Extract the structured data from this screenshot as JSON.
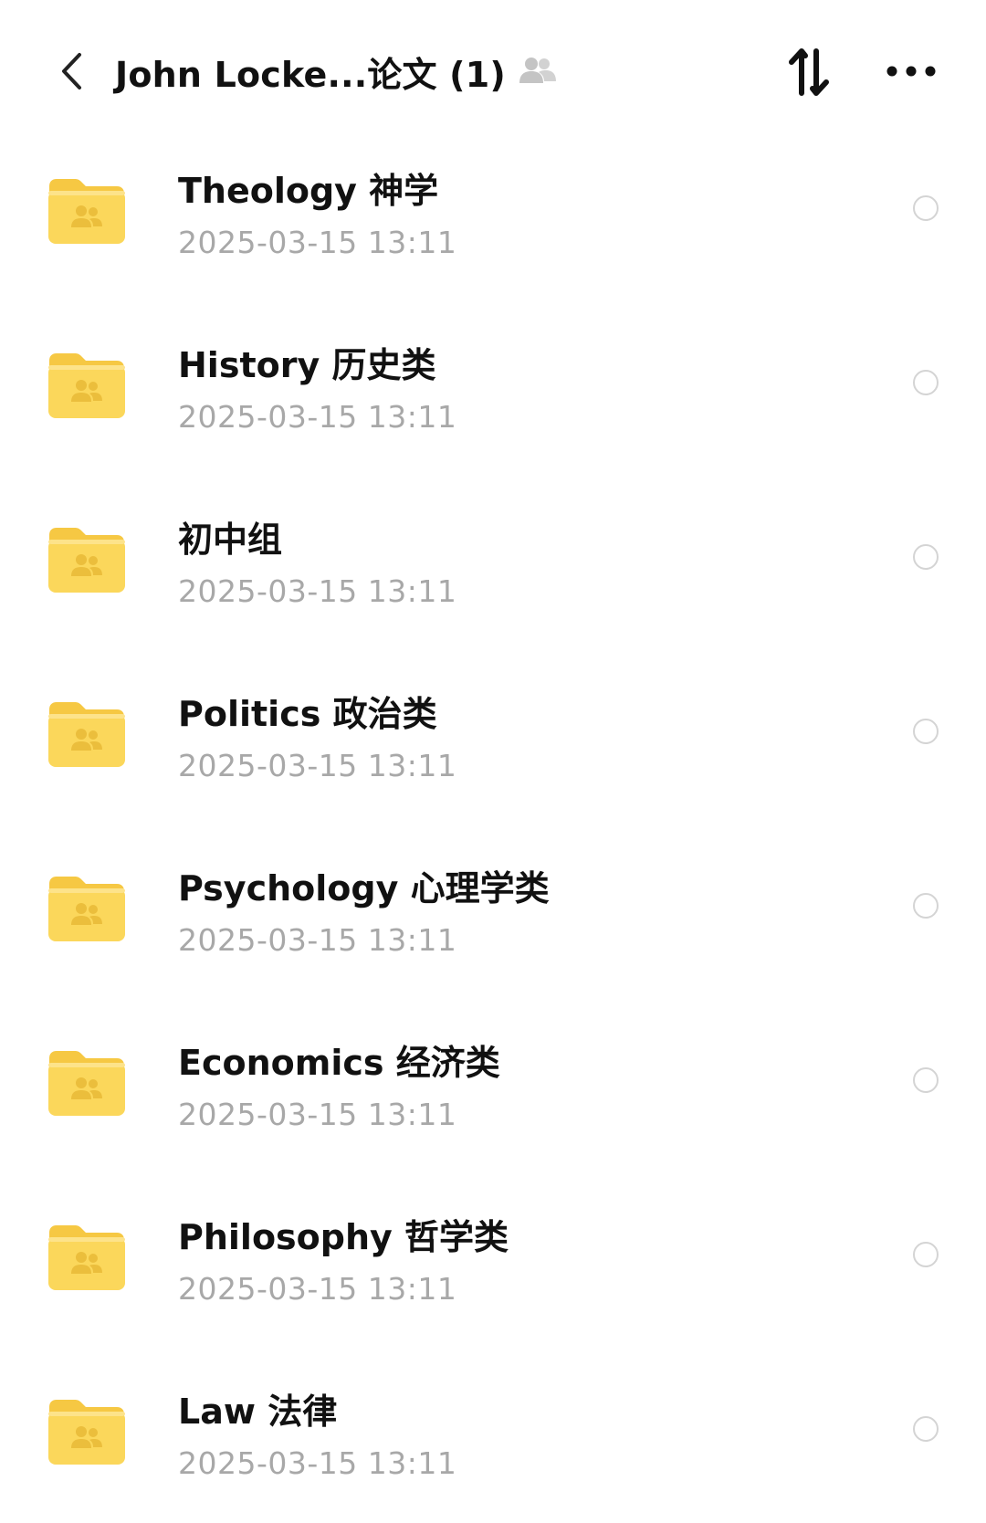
{
  "header": {
    "title": "John Locke...论文 (1)",
    "icons": {
      "back": "chevron-left-icon",
      "shared": "people-icon",
      "sort": "sort-arrows-icon",
      "more": "ellipsis-icon"
    }
  },
  "colors": {
    "folder": "#FBD75B",
    "folder_tab": "#F6C843",
    "date_text": "#A8A8A8",
    "circle": "#D4D4D4"
  },
  "folders": [
    {
      "name": "Theology 神学",
      "date": "2025-03-15 13:11"
    },
    {
      "name": "History 历史类",
      "date": "2025-03-15 13:11"
    },
    {
      "name": "初中组",
      "date": "2025-03-15 13:11"
    },
    {
      "name": "Politics 政治类",
      "date": "2025-03-15 13:11"
    },
    {
      "name": "Psychology 心理学类",
      "date": "2025-03-15 13:11"
    },
    {
      "name": "Economics 经济类",
      "date": "2025-03-15 13:11"
    },
    {
      "name": "Philosophy 哲学类",
      "date": "2025-03-15 13:11"
    },
    {
      "name": "Law 法律",
      "date": "2025-03-15 13:11"
    }
  ]
}
